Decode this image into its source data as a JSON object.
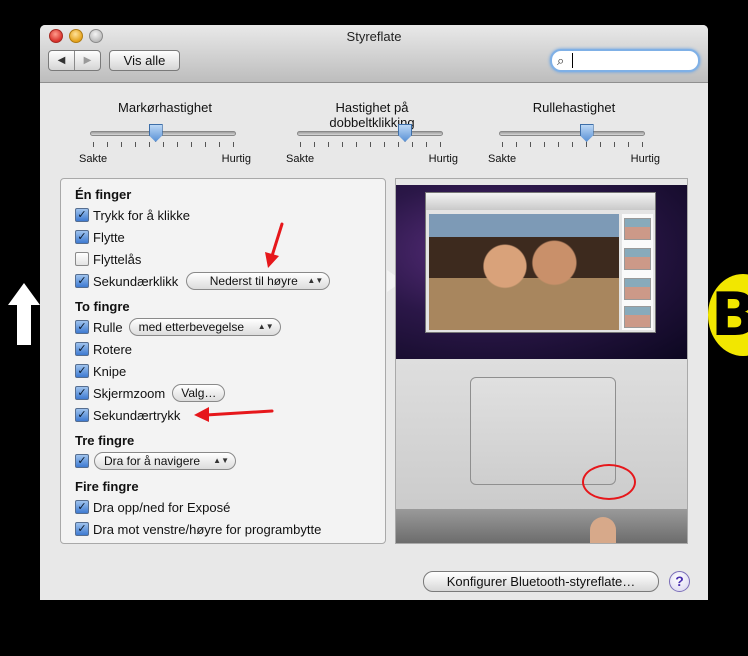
{
  "window": {
    "title": "Styreflate"
  },
  "toolbar": {
    "back_glyph": "◀",
    "forward_glyph": "▶",
    "show_all": "Vis alle",
    "search_placeholder": "",
    "search_icon": "magnifier-icon"
  },
  "sliders": [
    {
      "label": "Markørhastighet",
      "min_label": "Sakte",
      "max_label": "Hurtig",
      "value": 0.45
    },
    {
      "label": "Hastighet på dobbeltklikking",
      "min_label": "Sakte",
      "max_label": "Hurtig",
      "value": 0.74
    },
    {
      "label": "Rullehastighet",
      "min_label": "Sakte",
      "max_label": "Hurtig",
      "value": 0.6
    }
  ],
  "one_finger": {
    "title": "Én finger",
    "tap_to_click": {
      "label": "Trykk for å klikke",
      "checked": true
    },
    "move": {
      "label": "Flytte",
      "checked": true
    },
    "drag_lock": {
      "label": "Flyttelås",
      "checked": false
    },
    "secondary_click": {
      "label": "Sekundærklikk",
      "checked": true,
      "option": "Nederst til høyre"
    }
  },
  "two_fingers": {
    "title": "To fingre",
    "scroll": {
      "label": "Rulle",
      "checked": true,
      "option": "med etterbevegelse"
    },
    "rotate": {
      "label": "Rotere",
      "checked": true
    },
    "pinch": {
      "label": "Knipe",
      "checked": true
    },
    "screen_zoom": {
      "label": "Skjermzoom",
      "checked": true,
      "button": "Valg…"
    },
    "secondary_tap": {
      "label": "Sekundærtrykk",
      "checked": true
    }
  },
  "three_fingers": {
    "title": "Tre fingre",
    "navigate": {
      "checked": true,
      "option": "Dra for å navigere"
    }
  },
  "four_fingers": {
    "title": "Fire fingre",
    "expose": {
      "label": "Dra opp/ned for Exposé",
      "checked": true
    },
    "app_switch": {
      "label": "Dra mot venstre/høyre for programbytte",
      "checked": true
    }
  },
  "footer": {
    "bluetooth_button": "Konfigurer Bluetooth-styreflate…",
    "help": "?"
  },
  "overlays": {
    "badge_letter": "B",
    "accent_color": "#e6171b",
    "badge_color": "#f2e700"
  }
}
